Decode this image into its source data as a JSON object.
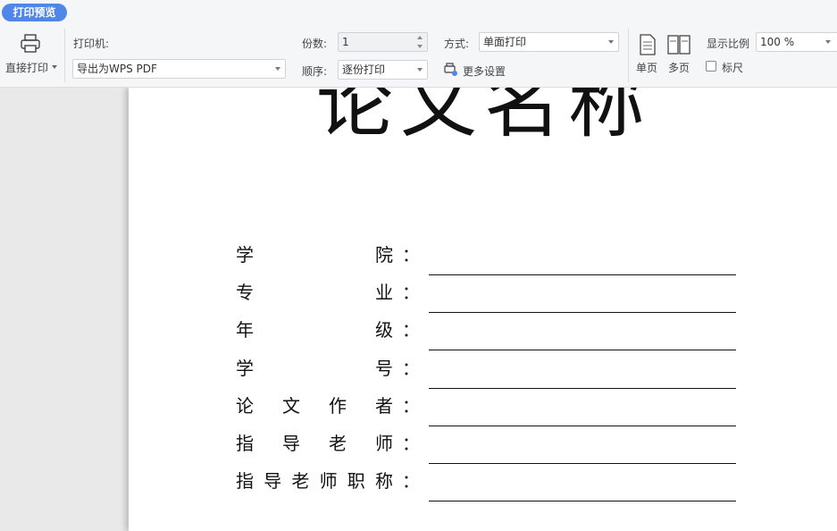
{
  "ribbon": {
    "tab_label": "打印预览",
    "direct_print_label": "直接打印",
    "printer_label": "打印机:",
    "printer_value": "导出为WPS PDF",
    "copies_label": "份数:",
    "copies_value": "1",
    "order_label": "顺序:",
    "order_value": "逐份打印",
    "mode_label": "方式:",
    "mode_value": "单面打印",
    "more_settings_label": "更多设置",
    "single_page_label": "单页",
    "multi_page_label": "多页",
    "zoom_label": "显示比例",
    "zoom_value": "100 %",
    "ruler_label": "标尺"
  },
  "document": {
    "title": "论文名称",
    "fields": [
      {
        "chars": [
          "学",
          "院"
        ]
      },
      {
        "chars": [
          "专",
          "业"
        ]
      },
      {
        "chars": [
          "年",
          "级"
        ]
      },
      {
        "chars": [
          "学",
          "号"
        ]
      },
      {
        "chars": [
          "论",
          "文",
          "作",
          "者"
        ]
      },
      {
        "chars": [
          "指",
          "导",
          "老",
          "师"
        ]
      },
      {
        "chars": [
          "指",
          "导",
          "老",
          "师",
          "职",
          "称"
        ]
      }
    ],
    "colon": "："
  },
  "colors": {
    "accent": "#4f86e7",
    "ribbon_bg": "#f5f6f7",
    "workspace_bg": "#e9e9e9"
  }
}
